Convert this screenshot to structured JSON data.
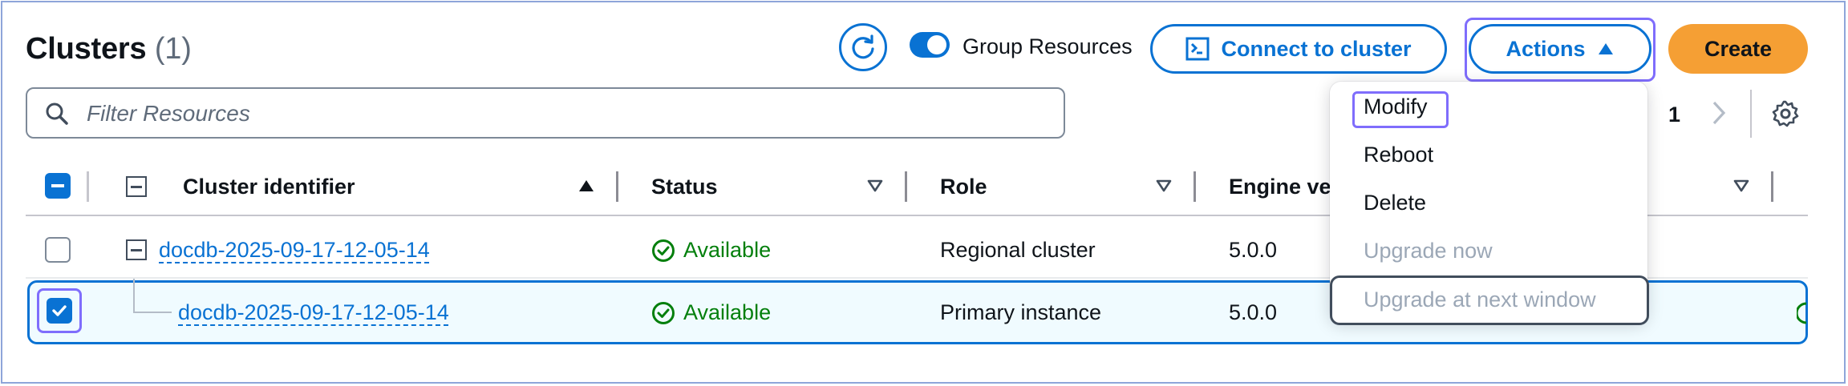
{
  "header": {
    "title": "Clusters",
    "count": "(1)",
    "group_resources_label": "Group Resources",
    "group_resources_on": true,
    "connect_label": "Connect to cluster",
    "actions_label": "Actions",
    "create_label": "Create"
  },
  "filter": {
    "placeholder": "Filter Resources",
    "value": ""
  },
  "pagination": {
    "current_page": "1"
  },
  "table": {
    "columns": [
      {
        "label": "Cluster identifier",
        "sort": "ascending"
      },
      {
        "label": "Status",
        "sort": "none"
      },
      {
        "label": "Role",
        "sort": "none"
      },
      {
        "label": "Engine ve",
        "sort": "none"
      }
    ],
    "rows": [
      {
        "identifier": "docdb-2025-09-17-12-05-14",
        "status": "Available",
        "role": "Regional cluster",
        "engine": "5.0.0",
        "selected": false
      },
      {
        "identifier": "docdb-2025-09-17-12-05-14",
        "status": "Available",
        "role": "Primary instance",
        "engine": "5.0.0",
        "selected": true
      }
    ]
  },
  "actions_menu": {
    "items": [
      {
        "label": "Modify",
        "disabled": false
      },
      {
        "label": "Reboot",
        "disabled": false
      },
      {
        "label": "Delete",
        "disabled": false
      },
      {
        "label": "Upgrade now",
        "disabled": true
      },
      {
        "label": "Upgrade at next window",
        "disabled": true
      }
    ]
  },
  "icons": {
    "refresh": "refresh-icon",
    "terminal": "terminal-icon",
    "caret_up": "caret-up-icon",
    "search": "search-icon",
    "chevron_right": "chevron-right-icon",
    "settings": "gear-icon",
    "check_circle": "status-positive-icon"
  },
  "colors": {
    "accent": "#0972d3",
    "create": "#f59f34",
    "success": "#037f0c",
    "focus": "#7f6dfc",
    "selected_row_bg": "#f0fbff"
  }
}
